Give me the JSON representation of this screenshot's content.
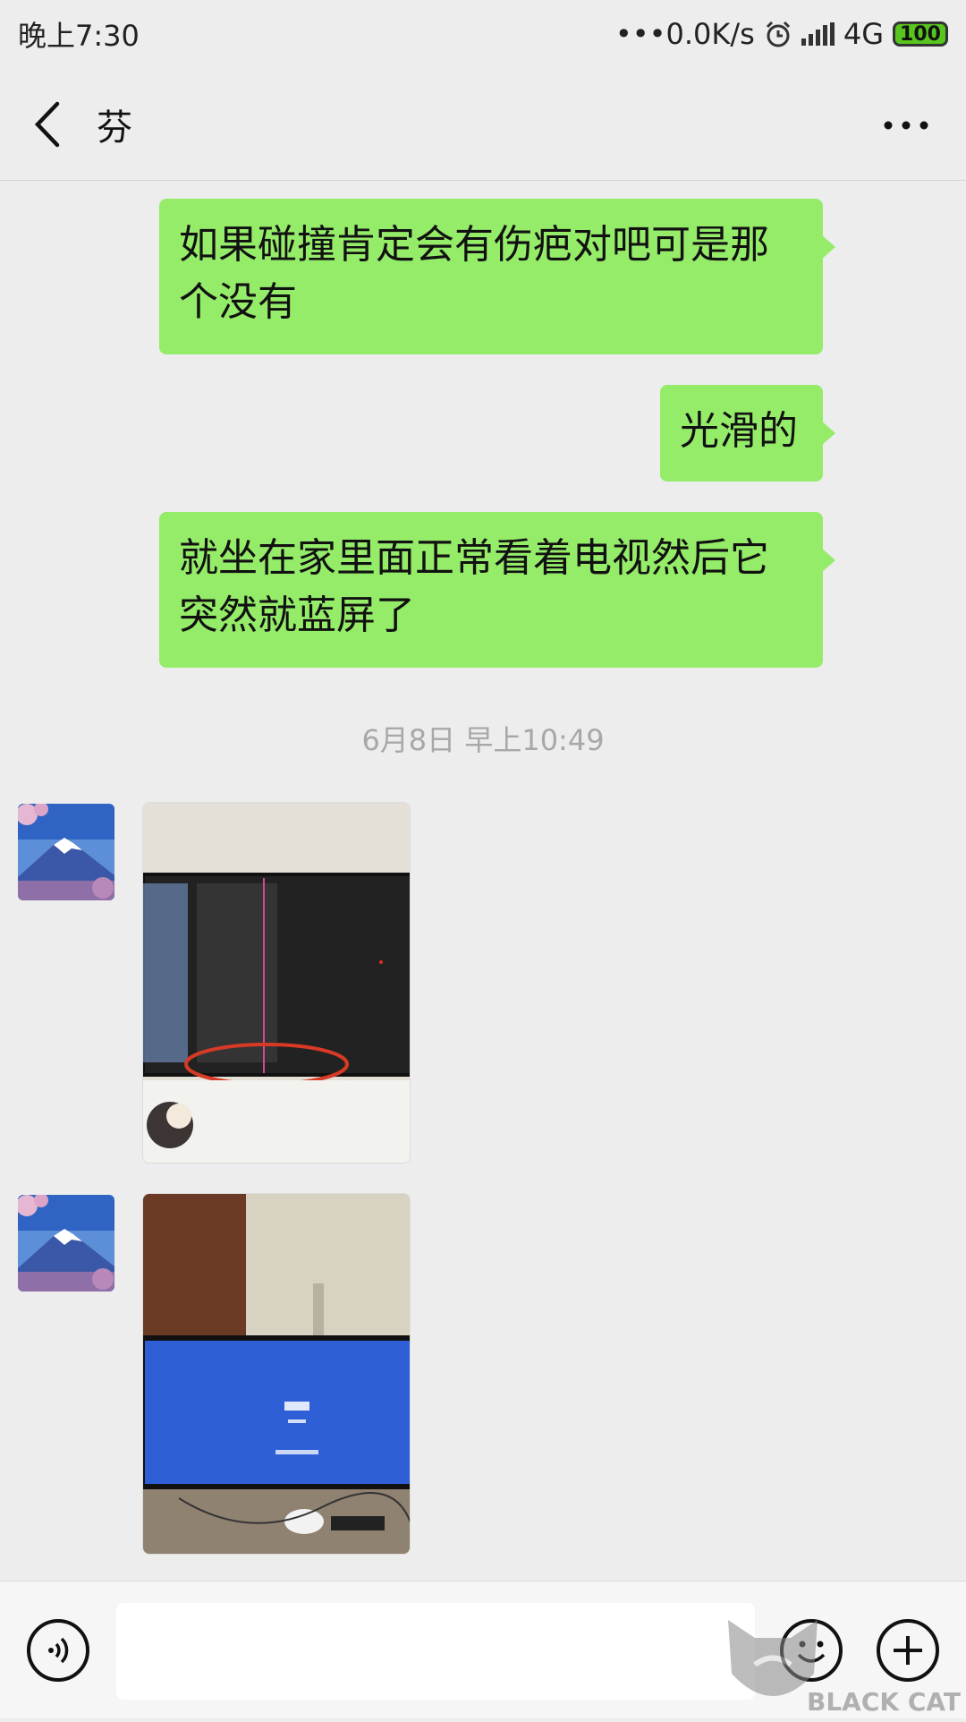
{
  "status_bar": {
    "time": "晚上7:30",
    "network_speed": "•••0.0K/s",
    "network_type": "4G",
    "battery": "100",
    "icons": [
      "alarm-icon",
      "signal-icon",
      "battery-icon"
    ]
  },
  "header": {
    "title": "芬",
    "back_icon": "chevron-left-icon",
    "more_icon": "more-icon"
  },
  "messages": [
    {
      "direction": "out",
      "type": "text",
      "text": "如果碰撞肯定会有伤疤对吧可是那个没有"
    },
    {
      "direction": "out",
      "type": "text",
      "text": "光滑的"
    },
    {
      "direction": "out",
      "type": "text",
      "text": "就坐在家里面正常看着电视然后它突然就蓝屏了"
    },
    {
      "type": "timestamp",
      "text": "6月8日 早上10:49"
    },
    {
      "direction": "in",
      "type": "image",
      "description": "photo-dark-tv-screen-crack"
    },
    {
      "direction": "in",
      "type": "image",
      "description": "photo-blue-tv-screen"
    }
  ],
  "input_bar": {
    "voice_icon": "voice-icon",
    "emoji_icon": "emoji-icon",
    "plus_icon": "plus-icon"
  },
  "watermark": {
    "text": "BLACK CAT"
  },
  "colors": {
    "background": "#ededed",
    "outgoing_bubble": "#95ec69",
    "timestamp": "#a8a8a8",
    "battery": "#57c51e"
  }
}
